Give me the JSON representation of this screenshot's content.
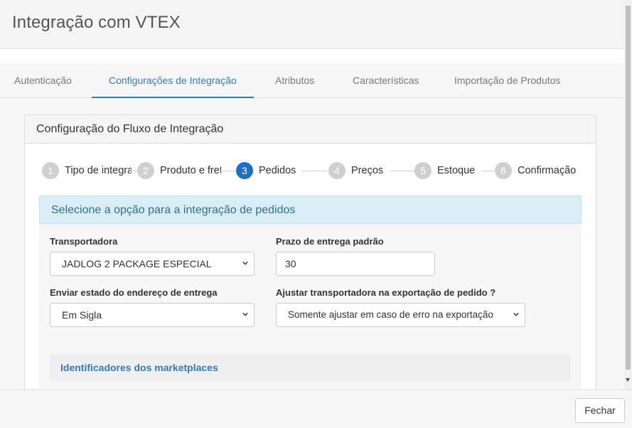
{
  "modal": {
    "title": "Integração com VTEX"
  },
  "tabs": [
    {
      "label": "Autenticação"
    },
    {
      "label": "Configurações de Integração"
    },
    {
      "label": "Atributos"
    },
    {
      "label": "Características"
    },
    {
      "label": "Importação de Produtos"
    }
  ],
  "panel": {
    "title": "Configuração do Fluxo de Integração"
  },
  "steps": [
    {
      "number": "1",
      "label": "Tipo de integração"
    },
    {
      "number": "2",
      "label": "Produto e frete"
    },
    {
      "number": "3",
      "label": "Pedidos"
    },
    {
      "number": "4",
      "label": "Preços"
    },
    {
      "number": "5",
      "label": "Estoque"
    },
    {
      "number": "6",
      "label": "Confirmação"
    }
  ],
  "section": {
    "title": "Selecione a opção para a integração de pedidos"
  },
  "form": {
    "carrier_label": "Transportadora",
    "carrier_value": "JADLOG 2 PACKAGE ESPECIAL",
    "delivery_label": "Prazo de entrega padrão",
    "delivery_value": "30",
    "state_label": "Enviar estado do endereço de entrega",
    "state_value": "Em Sigla",
    "adjust_label": "Ajustar transportadora na exportação de pedido ?",
    "adjust_value": "Somente ajustar em caso de erro na exportação"
  },
  "subpanel": {
    "title": "Identificadores dos marketplaces"
  },
  "footer": {
    "close_label": "Fechar"
  },
  "colors": {
    "accent": "#337ab7",
    "active_step": "#1f6fc5",
    "info_bg": "#d9edf7",
    "info_text": "#31708f"
  }
}
